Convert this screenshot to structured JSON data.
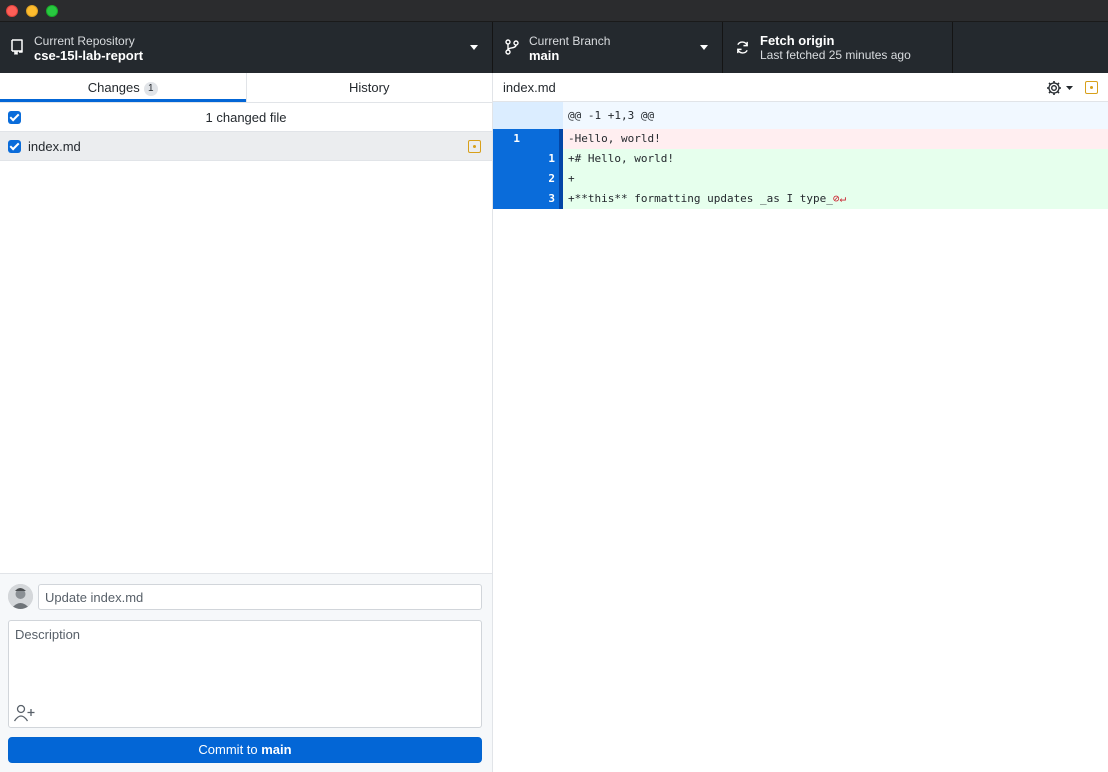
{
  "toolbar": {
    "repo_label": "Current Repository",
    "repo_value": "cse-15l-lab-report",
    "branch_label": "Current Branch",
    "branch_value": "main",
    "fetch_label": "Fetch origin",
    "fetch_status": "Last fetched 25 minutes ago"
  },
  "tabs": {
    "changes_label": "Changes",
    "changes_count": "1",
    "history_label": "History"
  },
  "changes": {
    "header": "1 changed file",
    "files": [
      {
        "name": "index.md",
        "status": "modified"
      }
    ]
  },
  "commit": {
    "summary_placeholder": "Update index.md",
    "description_placeholder": "Description",
    "button_prefix": "Commit to ",
    "button_branch": "main"
  },
  "diff": {
    "filename": "index.md",
    "hunk": "@@ -1 +1,3 @@",
    "lines": [
      {
        "type": "del",
        "old": "1",
        "new": "",
        "text": "-Hello, world!"
      },
      {
        "type": "add",
        "old": "",
        "new": "1",
        "text": "+# Hello, world!"
      },
      {
        "type": "add",
        "old": "",
        "new": "2",
        "text": "+"
      },
      {
        "type": "add",
        "old": "",
        "new": "3",
        "text": "+**this** formatting updates _as I type_"
      }
    ],
    "no_newline_marker": "⊘↵"
  },
  "colors": {
    "accent": "#0366d6",
    "modified": "#d8a01a",
    "deleted_bg": "#ffeef0",
    "added_bg": "#e6ffed"
  }
}
